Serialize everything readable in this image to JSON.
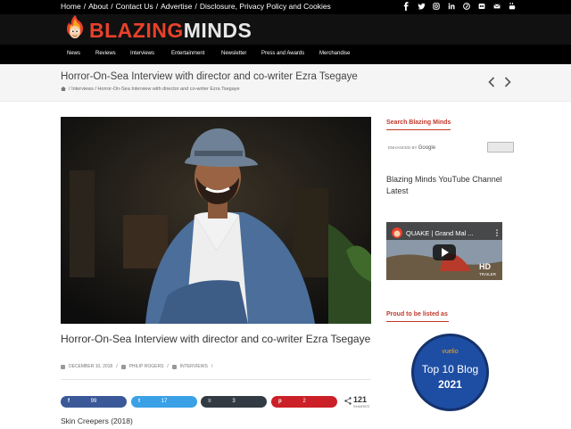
{
  "topbar": {
    "links": [
      "Home",
      "About",
      "Contact Us",
      "Advertise",
      "Disclosure, Privacy Policy and Cookies"
    ],
    "socials": [
      "facebook-icon",
      "twitter-icon",
      "instagram-icon",
      "linkedin-icon",
      "pinterest-icon",
      "flickr-icon",
      "email-icon",
      "youtube-icon"
    ]
  },
  "brand": {
    "part1": "BLAZING",
    "part2": "MINDS"
  },
  "nav": [
    "News",
    "Reviews",
    "Interviews",
    "Entertainment",
    "Newsletter",
    "Press and Awards",
    "Merchandise"
  ],
  "page": {
    "title": "Horror-On-Sea Interview with director and co-writer Ezra Tsegaye",
    "breadcrumbs": [
      "Interviews",
      "Horror-On-Sea Interview with director and co-writer Ezra Tsegaye"
    ]
  },
  "article": {
    "title": "Horror-On-Sea Interview with director and co-writer Ezra Tsegaye",
    "date": "DECEMBER 10, 2018",
    "author": "PHILIP ROGERS",
    "category": "INTERVIEWS",
    "subline": "Skin Creepers (2018)"
  },
  "share": {
    "buttons": [
      {
        "name": "facebook",
        "icon": "f",
        "count": "99",
        "color": "#3b5998"
      },
      {
        "name": "twitter",
        "icon": "t",
        "count": "17",
        "color": "#3aa1e6"
      },
      {
        "name": "buffer",
        "icon": "≡",
        "count": "3",
        "color": "#323b43"
      },
      {
        "name": "pinterest",
        "icon": "p",
        "count": "2",
        "color": "#cb2027"
      }
    ],
    "total": "121",
    "total_label": "SHARES"
  },
  "sidebar": {
    "search_heading": "Search Blazing Minds",
    "search_enhanced": "ENHANCED BY",
    "search_google": "Google",
    "youtube_heading": "Blazing Minds YouTube Channel Latest",
    "video_title": "QUAKE | Grand Mal ...",
    "video_badge": "HD",
    "video_badge_sub": "TRAILER",
    "proud_heading": "Proud to be listed as",
    "badge_brand": "vuelio",
    "badge_line1": "Top 10 Blog",
    "badge_line2": "2021"
  }
}
